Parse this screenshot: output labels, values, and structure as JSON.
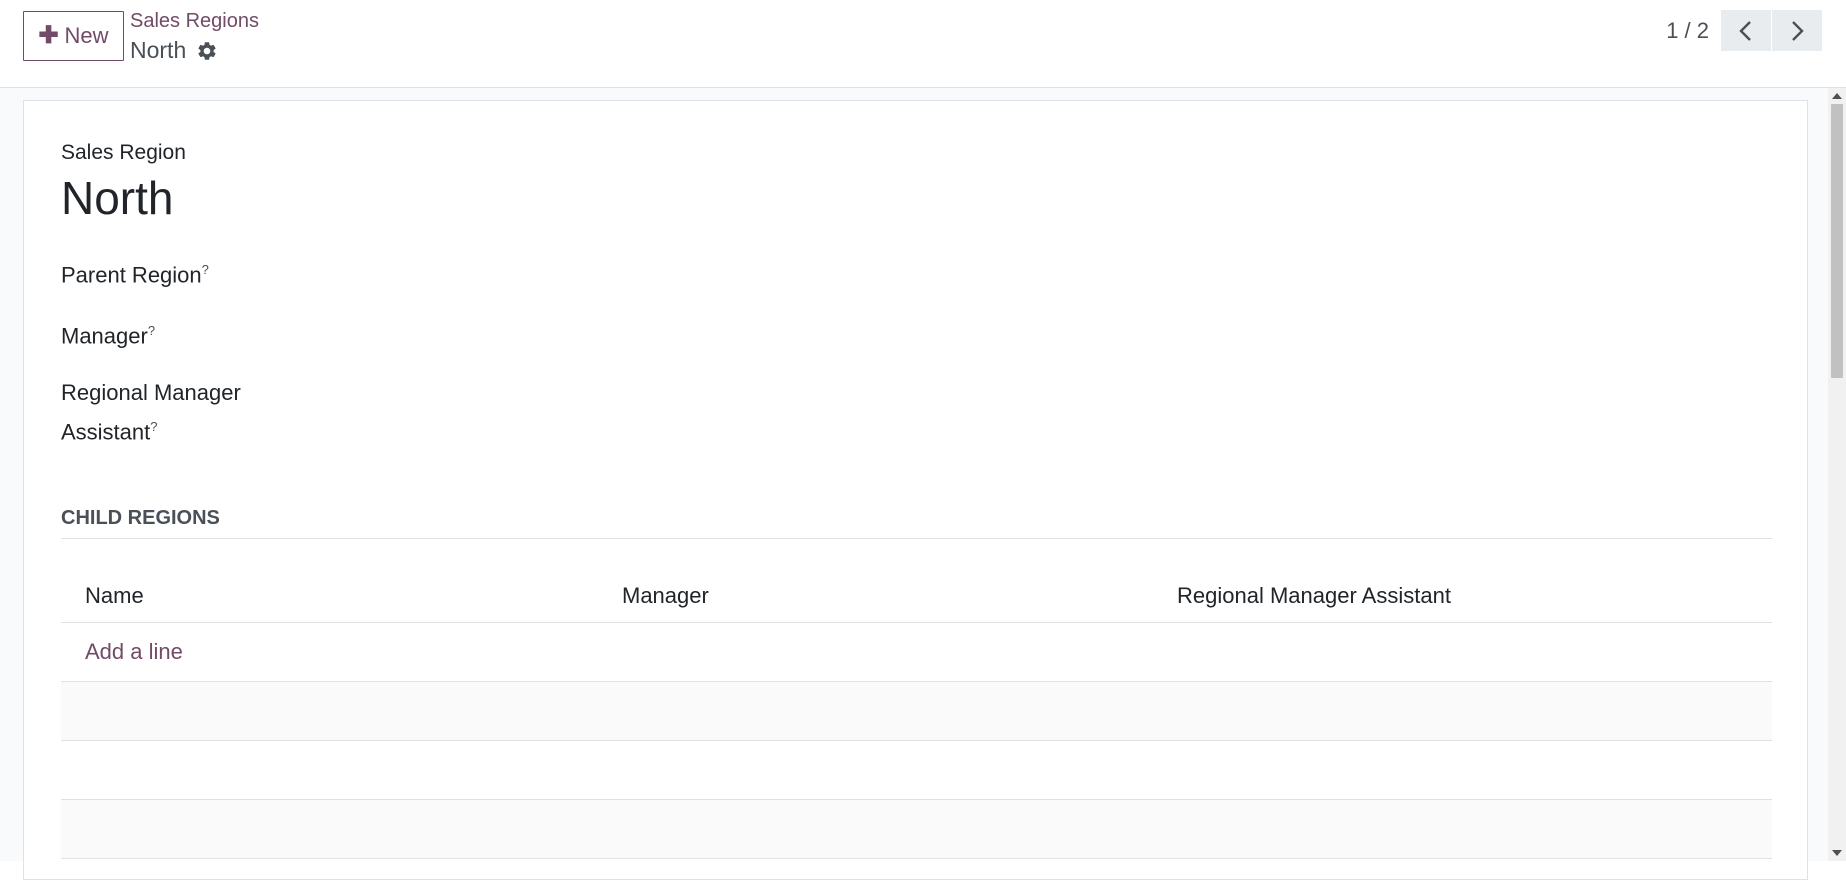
{
  "control_panel": {
    "new_button_label": "New",
    "breadcrumb_parent": "Sales Regions",
    "breadcrumb_current": "North",
    "pager_value": "1 / 2"
  },
  "form": {
    "region_label": "Sales Region",
    "region_name": "North",
    "fields": {
      "parent_region": {
        "label": "Parent Region",
        "help": "?",
        "value": ""
      },
      "manager": {
        "label": "Manager",
        "help": "?",
        "value": ""
      },
      "regional_manager_assistant": {
        "label": "Regional Manager Assistant",
        "help": "?",
        "value": ""
      }
    },
    "child_regions": {
      "title": "CHILD REGIONS",
      "columns": [
        "Name",
        "Manager",
        "Regional Manager Assistant"
      ],
      "add_line_label": "Add a line"
    }
  },
  "colors": {
    "accent": "#714b67",
    "border": "#dee2e6",
    "text": "#212529",
    "muted": "#495057"
  }
}
